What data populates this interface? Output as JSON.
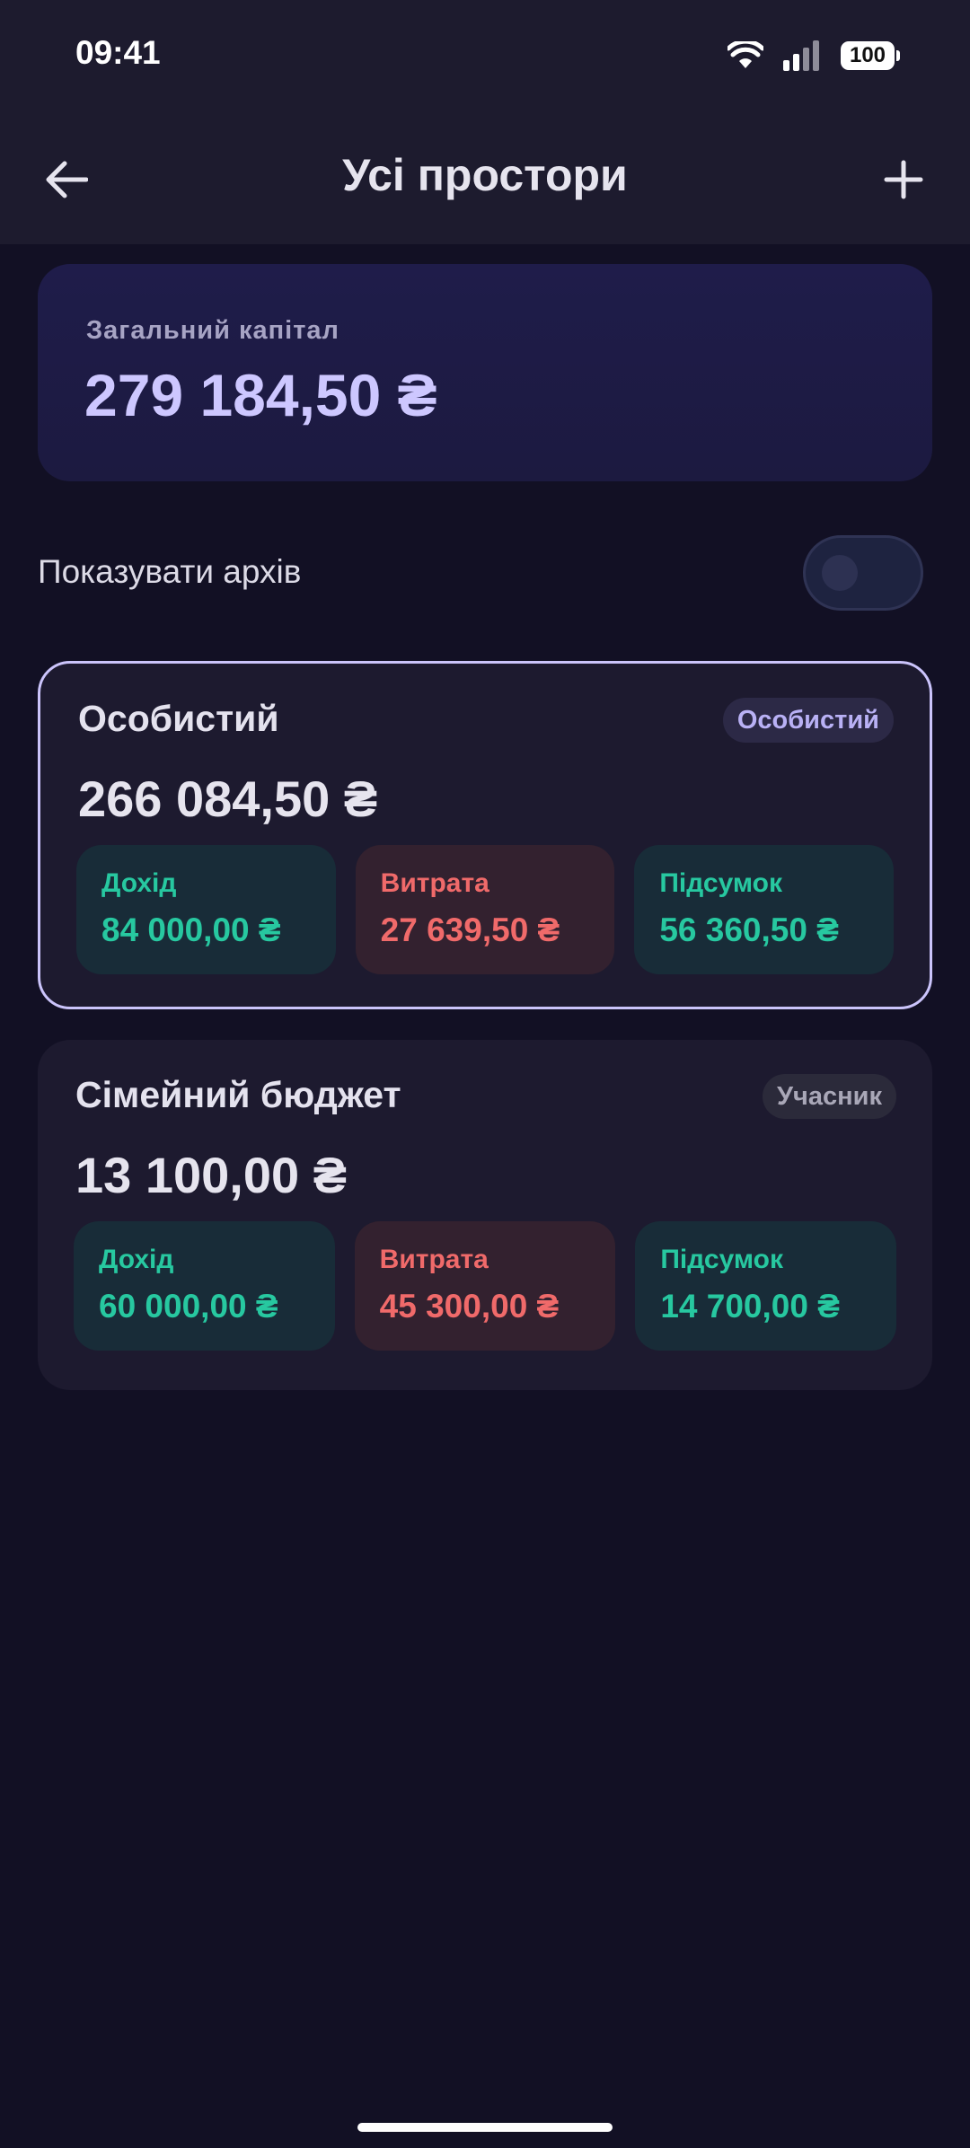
{
  "status_bar": {
    "time": "09:41",
    "battery": "100",
    "icons": [
      "wifi-icon",
      "signal-icon",
      "battery-icon"
    ]
  },
  "header": {
    "title": "Усі простори",
    "back_icon": "arrow-left-icon",
    "add_icon": "plus-icon"
  },
  "capital": {
    "label": "Загальний капітал",
    "value": "279 184,50 ₴"
  },
  "archive": {
    "label": "Показувати архів",
    "enabled": false
  },
  "spaces": [
    {
      "name": "Особистий",
      "badge": "Особистий",
      "balance": "266 084,50 ₴",
      "selected": true,
      "income_label": "Дохід",
      "income": "84 000,00 ₴",
      "expense_label": "Витрата",
      "expense": "27 639,50 ₴",
      "summary_label": "Підсумок",
      "summary": "56 360,50 ₴"
    },
    {
      "name": "Сімейний бюджет",
      "badge": "Учасник",
      "balance": "13 100,00 ₴",
      "selected": false,
      "income_label": "Дохід",
      "income": "60 000,00 ₴",
      "expense_label": "Витрата",
      "expense": "45 300,00 ₴",
      "summary_label": "Підсумок",
      "summary": "14 700,00 ₴"
    }
  ],
  "colors": {
    "background": "#121024",
    "accent": "#cdc7ff",
    "income": "#27c8a0",
    "expense": "#f06a6a"
  }
}
